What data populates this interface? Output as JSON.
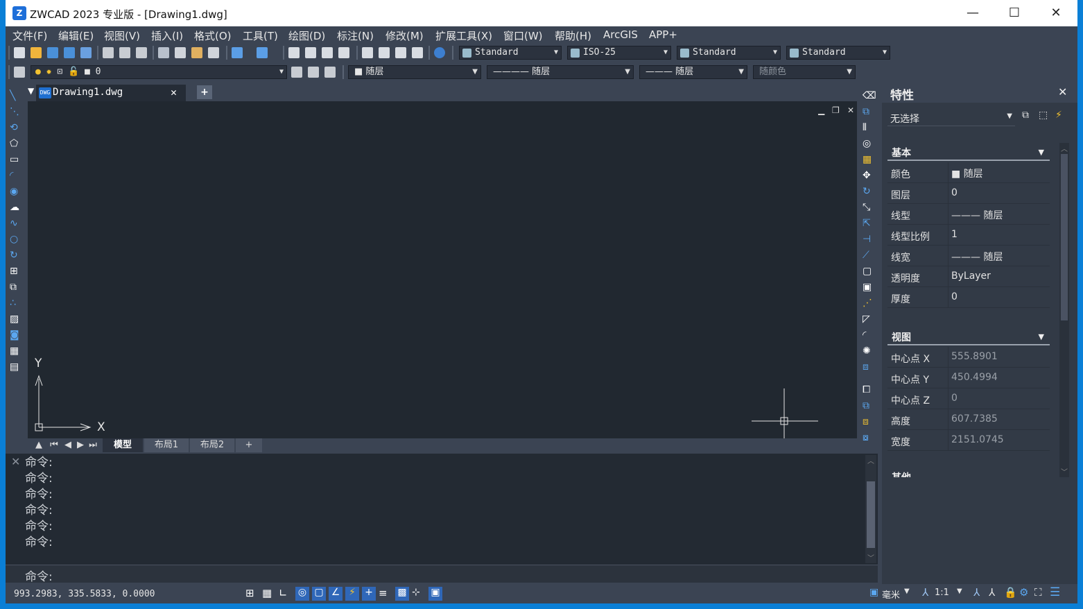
{
  "window": {
    "title": "ZWCAD 2023 专业版 - [Drawing1.dwg]",
    "minimize": "—",
    "maximize": "☐",
    "close": "✕"
  },
  "menu": [
    "文件(F)",
    "编辑(E)",
    "视图(V)",
    "插入(I)",
    "格式(O)",
    "工具(T)",
    "绘图(D)",
    "标注(N)",
    "修改(M)",
    "扩展工具(X)",
    "窗口(W)",
    "帮助(H)",
    "ArcGIS",
    "APP+"
  ],
  "toolbar": {
    "text_style": "Standard",
    "dim_style": "ISO-25",
    "table_style": "Standard",
    "multileader_style": "Standard",
    "layer": "0",
    "color": "随层",
    "linetype": "随层",
    "lineweight": "随层",
    "plot_style": "随颜色"
  },
  "document": {
    "tab_name": "Drawing1.dwg",
    "tab_close": "✕",
    "new_tab": "+"
  },
  "canvas": {
    "axis_x": "X",
    "axis_y": "Y"
  },
  "layout_tabs": [
    "模型",
    "布局1",
    "布局2",
    "+"
  ],
  "command": {
    "history": [
      "命令:",
      "命令:",
      "命令:",
      "命令:",
      "命令:",
      "命令:"
    ],
    "prompt": "命令:"
  },
  "status": {
    "coords": "993.2983,  335.5833,  0.0000",
    "units": "毫米",
    "scale": "1:1"
  },
  "properties": {
    "title": "特性",
    "selection": "无选择",
    "section_basic": "基本",
    "basic": [
      {
        "key": "颜色",
        "value": "随层"
      },
      {
        "key": "图层",
        "value": "0"
      },
      {
        "key": "线型",
        "value": "——— 随层"
      },
      {
        "key": "线型比例",
        "value": "1"
      },
      {
        "key": "线宽",
        "value": "——— 随层"
      },
      {
        "key": "透明度",
        "value": "ByLayer"
      },
      {
        "key": "厚度",
        "value": "0"
      }
    ],
    "section_view": "视图",
    "view": [
      {
        "key": "中心点 X",
        "value": "555.8901"
      },
      {
        "key": "中心点 Y",
        "value": "450.4994"
      },
      {
        "key": "中心点 Z",
        "value": "0"
      },
      {
        "key": "高度",
        "value": "607.7385"
      },
      {
        "key": "宽度",
        "value": "2151.0745"
      }
    ],
    "section_other": "其他"
  },
  "colors": {
    "accent": "#0a7fd6",
    "panel": "#3b4453",
    "canvas": "#212830"
  }
}
